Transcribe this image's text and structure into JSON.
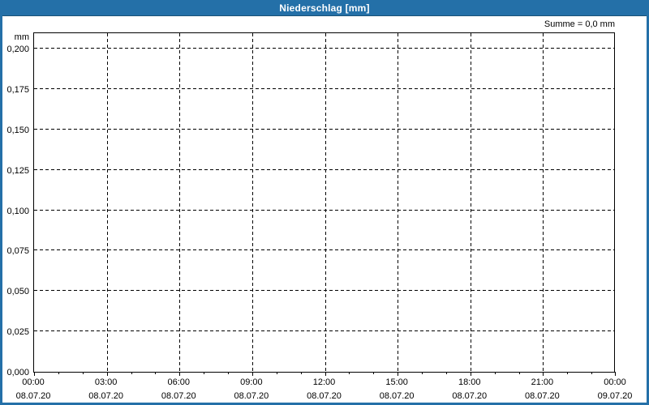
{
  "header": {
    "title": "Niederschlag [mm]"
  },
  "summary": {
    "text": "Summe = 0,0 mm"
  },
  "chart_data": {
    "type": "bar",
    "title": "Niederschlag [mm]",
    "subtitle": "",
    "xlabel": "",
    "ylabel": "mm",
    "summary_text": "Summe = 0,0 mm",
    "ylim": [
      0,
      0.2
    ],
    "y_tick_step": 0.025,
    "y_tick_labels": [
      "0,000",
      "0,025",
      "0,050",
      "0,075",
      "0,100",
      "0,125",
      "0,150",
      "0,175",
      "0,200"
    ],
    "x_range_hours": [
      0,
      24
    ],
    "x_major_step_hours": 3,
    "x_minor_step_hours": 1,
    "x_major_ticks": [
      {
        "time": "00:00",
        "date": "08.07.20"
      },
      {
        "time": "03:00",
        "date": "08.07.20"
      },
      {
        "time": "06:00",
        "date": "08.07.20"
      },
      {
        "time": "09:00",
        "date": "08.07.20"
      },
      {
        "time": "12:00",
        "date": "08.07.20"
      },
      {
        "time": "15:00",
        "date": "08.07.20"
      },
      {
        "time": "18:00",
        "date": "08.07.20"
      },
      {
        "time": "21:00",
        "date": "08.07.20"
      },
      {
        "time": "00:00",
        "date": "09.07.20"
      }
    ],
    "series": [
      {
        "name": "Niederschlag",
        "values": []
      }
    ],
    "grid": {
      "horizontal": "dashed",
      "vertical": "dashed",
      "minor_x_ticks": true
    },
    "legend": "none",
    "colors": {
      "accent_blue": "#2470a8",
      "title_text": "#ffffff",
      "grid": "#000000",
      "axis": "#000000",
      "text": "#000000",
      "plot_background": "#ffffff"
    }
  }
}
